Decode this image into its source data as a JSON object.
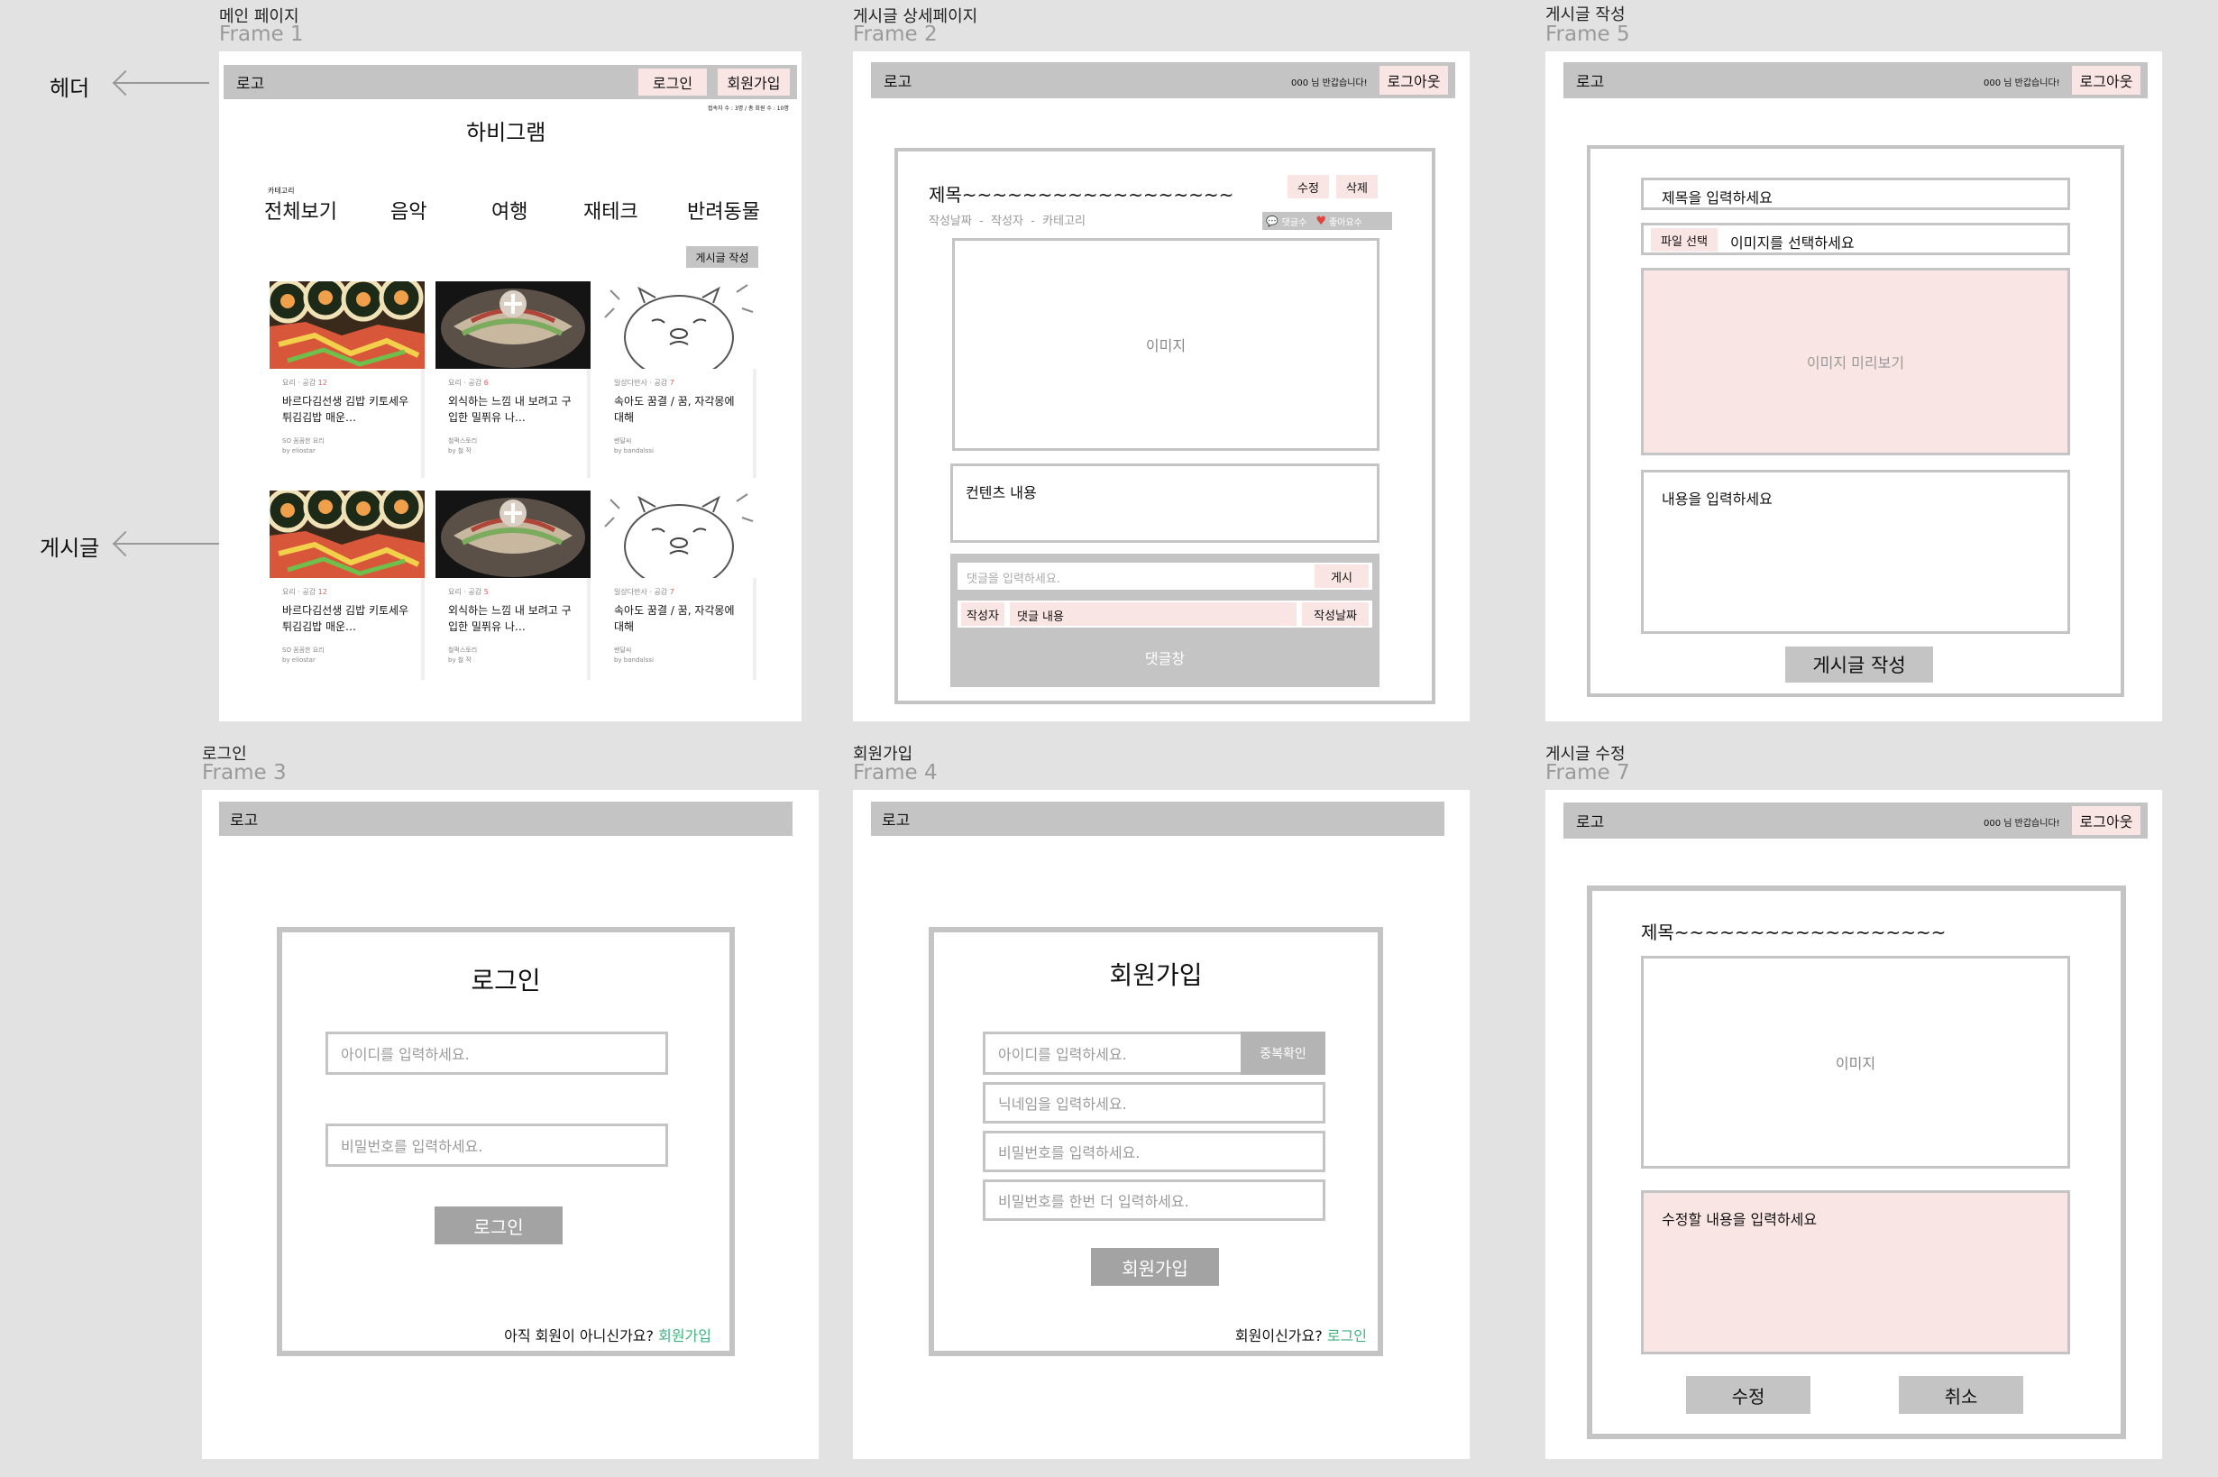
{
  "annotations": {
    "header": "헤더",
    "post": "게시글"
  },
  "frames": {
    "main": {
      "title": "메인 페이지",
      "sub": "Frame 1"
    },
    "detail": {
      "title": "게시글 상세페이지",
      "sub": "Frame 2"
    },
    "write": {
      "title": "게시글 작성",
      "sub": "Frame 5"
    },
    "login": {
      "title": "로그인",
      "sub": "Frame 3"
    },
    "signup": {
      "title": "회원가입",
      "sub": "Frame 4"
    },
    "edit": {
      "title": "게시글 수정",
      "sub": "Frame 7"
    }
  },
  "header": {
    "logo": "로고",
    "login": "로그인",
    "signup": "회원가입",
    "greeting": "000 님 반갑습니다!",
    "logout": "로그아웃"
  },
  "main": {
    "stats": "접속자 수 : 3명 / 총 회원 수 : 10명",
    "site_title": "하비그램",
    "category_caption": "카테고리",
    "categories": [
      "전체보기",
      "음악",
      "여행",
      "재테크",
      "반려동물"
    ],
    "write_button": "게시글 작성",
    "cards": [
      {
        "cat": "요리",
        "likes_label": "공감",
        "likes": "12",
        "title": "바르다김선생 김밥 키토세우튀김김밥 매운…",
        "blog": "SO 꼼꼼한 요리",
        "author": "by eliostar"
      },
      {
        "cat": "요리",
        "likes_label": "공감",
        "likes": "6",
        "title": "외식하는 느낌 내 보려고 구입한 밀퓌유 나…",
        "blog": "철퍽스토리",
        "author": "by 철 작"
      },
      {
        "cat": "일상다반사",
        "likes_label": "공감",
        "likes": "7",
        "title": "속아도 꿈결 / 꿈, 자각몽에 대해",
        "blog": "밴달씨",
        "author": "by bandalssi"
      },
      {
        "cat": "요리",
        "likes_label": "공감",
        "likes": "12",
        "title": "바르다김선생 김밥 키토세우튀김김밥 매운…",
        "blog": "SO 꼼꼼한 요리",
        "author": "by eliostar"
      },
      {
        "cat": "요리",
        "likes_label": "공감",
        "likes": "5",
        "title": "외식하는 느낌 내 보려고 구입한 밀퓌유 나…",
        "blog": "철퍽스토리",
        "author": "by 철 작"
      },
      {
        "cat": "일상다반사",
        "likes_label": "공감",
        "likes": "7",
        "title": "속아도 꿈결 / 꿈, 자각몽에 대해",
        "blog": "밴달씨",
        "author": "by bandalssi"
      }
    ]
  },
  "detail": {
    "title": "제목~~~~~~~~~~~~~~~~~~",
    "meta": "작성날짜  -  작성자  -  카테고리",
    "edit": "수정",
    "delete": "삭제",
    "comment_count": "댓글수",
    "like_count": "좋아요수",
    "image": "이미지",
    "content": "컨텐츠 내용",
    "comment_placeholder": "댓글을 입력하세요.",
    "comment_post": "게시",
    "comment_writer": "작성자",
    "comment_content": "댓글 내용",
    "comment_date": "작성날짜",
    "comment_area": "댓글창"
  },
  "write": {
    "title_placeholder": "제목을 입력하세요",
    "file_button": "파일 선택",
    "file_label": "이미지를 선택하세요",
    "preview": "이미지 미리보기",
    "content_placeholder": "내용을 입력하세요",
    "submit": "게시글 작성"
  },
  "login": {
    "heading": "로그인",
    "id_placeholder": "아이디를 입력하세요.",
    "pw_placeholder": "비밀번호를 입력하세요.",
    "submit": "로그인",
    "prompt": "아직 회원이 아니신가요?",
    "link": "회원가입"
  },
  "signup": {
    "heading": "회원가입",
    "id_placeholder": "아이디를 입력하세요.",
    "dup_check": "중복확인",
    "nick_placeholder": "닉네임을 입력하세요.",
    "pw_placeholder": "비밀번호를 입력하세요.",
    "pw2_placeholder": "비밀번호를 한번 더 입력하세요.",
    "submit": "회원가입",
    "prompt": "회원이신가요?",
    "link": "로그인"
  },
  "edit": {
    "title": "제목~~~~~~~~~~~~~~~~~~",
    "image": "이미지",
    "content_placeholder": "수정할 내용을 입력하세요",
    "save": "수정",
    "cancel": "취소"
  },
  "colors": {
    "gray": "#c4c4c4",
    "pink": "#f9e5e4",
    "green_link": "#3fb27f",
    "heart": "#e0443e"
  }
}
